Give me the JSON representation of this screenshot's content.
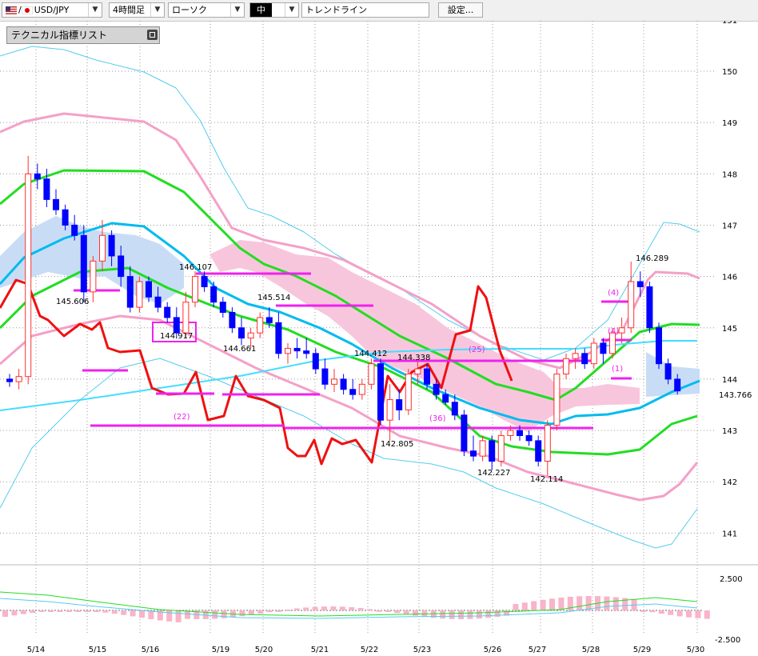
{
  "toolbar": {
    "pair": "USD/JPY",
    "timeframe": "4時間足",
    "chart_style": "ローソク",
    "size": "中",
    "drawing_tool": "トレンドライン",
    "settings_label": "設定..."
  },
  "indicator_panel": {
    "title": "テクニカル指標リスト"
  },
  "colors": {
    "bull_candle": "#ff3030",
    "bear_candle": "#0000ff",
    "cloud_bull": "#c8ddf5",
    "cloud_bear": "#f8c6dc",
    "line_red": "#ee1111",
    "ma_green": "#22dd22",
    "ma_blue": "#00bbee",
    "band_pink": "#f4a0c8",
    "band_cyan": "#55ccee",
    "trendline_magenta": "#ee22ee"
  },
  "chart_data": {
    "type": "candlestick",
    "title": "",
    "x_labels": [
      "5/14",
      "5/15",
      "5/16",
      "5/19",
      "5/20",
      "5/21",
      "5/22",
      "5/23",
      "5/26",
      "5/27",
      "5/28",
      "5/29",
      "5/30"
    ],
    "y_ticks": [
      "151",
      "150",
      "149",
      "148",
      "147",
      "146",
      "145",
      "144",
      "143",
      "142",
      "141"
    ],
    "oscillator_ticks": [
      "2.500",
      "-2.500"
    ],
    "ylim": [
      140.5,
      151.2
    ],
    "grid": true,
    "current_price": "143.766",
    "price_annotations": [
      {
        "label": "145.606",
        "value": 145.6
      },
      {
        "label": "146.107",
        "value": 146.1
      },
      {
        "label": "145.514",
        "value": 145.51
      },
      {
        "label": "144.917",
        "value": 144.92
      },
      {
        "label": "144.661",
        "value": 144.66
      },
      {
        "label": "144.412",
        "value": 144.41
      },
      {
        "label": "144.338",
        "value": 144.34
      },
      {
        "label": "142.805",
        "value": 142.8
      },
      {
        "label": "142.227",
        "value": 142.23
      },
      {
        "label": "142.114",
        "value": 142.11
      },
      {
        "label": "146.289",
        "value": 146.29
      }
    ],
    "count_labels": [
      "(22)",
      "(36)",
      "(25)",
      "(4)",
      "(4)",
      "(1)"
    ],
    "candles": [
      [
        144.0,
        144.1,
        143.85,
        143.95
      ],
      [
        143.95,
        144.2,
        143.8,
        144.05
      ],
      [
        144.05,
        148.35,
        143.9,
        148.0
      ],
      [
        148.0,
        148.2,
        147.7,
        147.9
      ],
      [
        147.9,
        148.1,
        147.35,
        147.5
      ],
      [
        147.5,
        147.7,
        147.2,
        147.3
      ],
      [
        147.3,
        147.4,
        146.9,
        147.0
      ],
      [
        147.0,
        147.2,
        146.7,
        146.8
      ],
      [
        146.8,
        147.0,
        145.5,
        145.7
      ],
      [
        145.7,
        146.4,
        145.5,
        146.3
      ],
      [
        146.3,
        147.1,
        146.1,
        146.8
      ],
      [
        146.8,
        146.9,
        146.2,
        146.4
      ],
      [
        146.4,
        146.6,
        145.8,
        146.0
      ],
      [
        146.0,
        146.2,
        145.3,
        145.4
      ],
      [
        145.4,
        146.0,
        145.3,
        145.9
      ],
      [
        145.9,
        146.0,
        145.5,
        145.6
      ],
      [
        145.6,
        145.8,
        145.3,
        145.4
      ],
      [
        145.4,
        145.5,
        145.1,
        145.2
      ],
      [
        145.2,
        145.4,
        144.8,
        144.9
      ],
      [
        144.9,
        145.7,
        144.8,
        145.5
      ],
      [
        145.5,
        146.1,
        145.4,
        146.0
      ],
      [
        146.0,
        146.1,
        145.7,
        145.8
      ],
      [
        145.8,
        145.9,
        145.4,
        145.5
      ],
      [
        145.5,
        145.6,
        145.2,
        145.3
      ],
      [
        145.3,
        145.4,
        144.9,
        145.0
      ],
      [
        145.0,
        145.2,
        144.66,
        144.8
      ],
      [
        144.8,
        145.0,
        144.6,
        144.9
      ],
      [
        144.9,
        145.3,
        144.8,
        145.2
      ],
      [
        145.2,
        145.4,
        145.0,
        145.1
      ],
      [
        145.1,
        145.3,
        144.4,
        144.5
      ],
      [
        144.5,
        144.7,
        144.3,
        144.6
      ],
      [
        144.6,
        144.8,
        144.4,
        144.55
      ],
      [
        144.55,
        144.8,
        144.4,
        144.5
      ],
      [
        144.5,
        144.6,
        144.1,
        144.2
      ],
      [
        144.2,
        144.4,
        143.8,
        143.9
      ],
      [
        143.9,
        144.2,
        143.75,
        144.0
      ],
      [
        144.0,
        144.1,
        143.7,
        143.8
      ],
      [
        143.8,
        144.0,
        143.6,
        143.7
      ],
      [
        143.7,
        144.0,
        143.6,
        143.9
      ],
      [
        143.9,
        144.4,
        143.8,
        144.3
      ],
      [
        144.3,
        144.4,
        143.1,
        143.2
      ],
      [
        143.2,
        143.9,
        142.8,
        143.6
      ],
      [
        143.6,
        143.8,
        143.2,
        143.4
      ],
      [
        143.4,
        144.2,
        143.3,
        144.1
      ],
      [
        144.1,
        144.34,
        143.9,
        144.2
      ],
      [
        144.2,
        144.3,
        143.8,
        143.9
      ],
      [
        143.9,
        144.0,
        143.6,
        143.7
      ],
      [
        143.7,
        143.8,
        143.5,
        143.55
      ],
      [
        143.55,
        143.7,
        143.2,
        143.3
      ],
      [
        143.3,
        143.4,
        142.5,
        142.6
      ],
      [
        142.6,
        142.9,
        142.4,
        142.5
      ],
      [
        142.5,
        142.9,
        142.4,
        142.8
      ],
      [
        142.8,
        142.9,
        142.23,
        142.4
      ],
      [
        142.4,
        143.0,
        142.3,
        142.9
      ],
      [
        142.9,
        143.1,
        142.8,
        143.0
      ],
      [
        143.0,
        143.1,
        142.8,
        142.9
      ],
      [
        142.9,
        143.0,
        142.7,
        142.8
      ],
      [
        142.8,
        142.9,
        142.3,
        142.4
      ],
      [
        142.4,
        143.2,
        142.11,
        143.1
      ],
      [
        143.1,
        144.2,
        143.0,
        144.1
      ],
      [
        144.1,
        144.5,
        144.0,
        144.4
      ],
      [
        144.4,
        144.6,
        144.2,
        144.5
      ],
      [
        144.5,
        144.6,
        144.2,
        144.3
      ],
      [
        144.3,
        144.8,
        144.2,
        144.7
      ],
      [
        144.7,
        144.8,
        144.3,
        144.5
      ],
      [
        144.5,
        145.0,
        144.4,
        144.9
      ],
      [
        144.9,
        145.2,
        144.7,
        145.0
      ],
      [
        145.0,
        146.29,
        144.9,
        145.9
      ],
      [
        145.9,
        146.1,
        145.6,
        145.8
      ],
      [
        145.8,
        145.9,
        144.9,
        145.0
      ],
      [
        145.0,
        145.1,
        144.2,
        144.3
      ],
      [
        144.3,
        144.4,
        143.9,
        144.0
      ],
      [
        144.0,
        144.1,
        143.7,
        143.77
      ]
    ]
  }
}
